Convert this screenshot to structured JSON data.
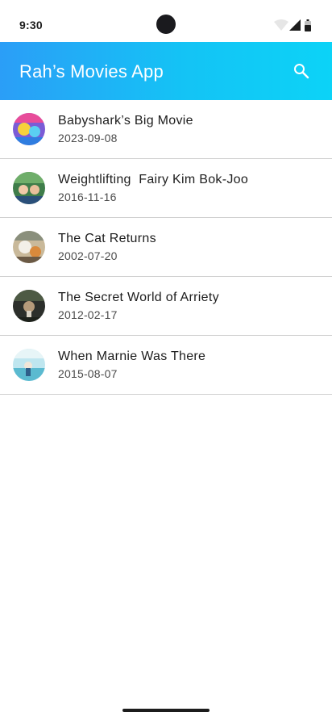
{
  "status_bar": {
    "time": "9:30",
    "icons": [
      "wifi-icon",
      "cellular-signal-icon",
      "battery-icon"
    ]
  },
  "app_bar": {
    "title": "Rah’s Movies App",
    "actions": [
      "search-icon"
    ],
    "gradient": [
      "#2b9ef7",
      "#0cd3f7"
    ]
  },
  "movies": [
    {
      "title": "Babyshark’s Big Movie",
      "release_date": "2023-09-08"
    },
    {
      "title": "Weightlifting  Fairy Kim Bok-Joo",
      "release_date": "2016-11-16"
    },
    {
      "title": "The Cat Returns",
      "release_date": "2002-07-20"
    },
    {
      "title": "The Secret World of Arriety",
      "release_date": "2012-02-17"
    },
    {
      "title": "When Marnie Was There",
      "release_date": "2015-08-07"
    }
  ]
}
